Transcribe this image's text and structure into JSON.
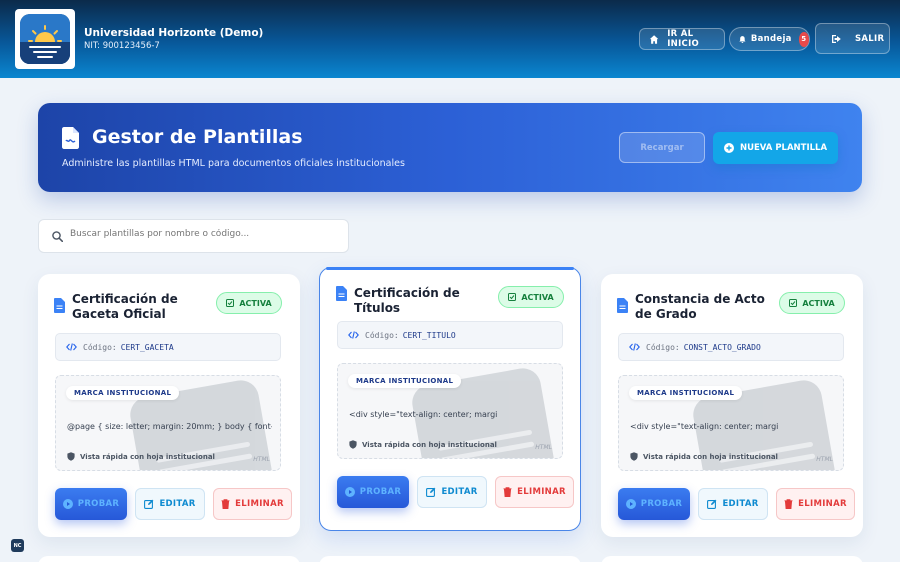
{
  "header": {
    "org_name": "Universidad Horizonte (Demo)",
    "org_nit": "NIT: 900123456-7",
    "home_label": "IR AL INICIO",
    "inbox_label": "Bandeja",
    "inbox_count": "5",
    "logout_label": "SALIR"
  },
  "hero": {
    "title": "Gestor de Plantillas",
    "subtitle": "Administre las plantillas HTML para documentos oficiales institucionales",
    "secondary_label": "Recargar",
    "new_label": "NUEVA PLANTILLA"
  },
  "search": {
    "placeholder": "Buscar plantillas por nombre o código..."
  },
  "labels": {
    "code_prefix": "Código:",
    "brand_chip": "MARCA INSTITUCIONAL",
    "quick_view": "Vista rápida con hoja institucional",
    "html_tag": "HTML",
    "try": "PROBAR",
    "edit": "EDITAR",
    "delete": "ELIMINAR"
  },
  "templates": [
    {
      "title": "Certificación de Gaceta Oficial",
      "status": "ACTIVA",
      "code": "CERT_GACETA",
      "snippet": "@page { size: letter; margin: 20mm; } body { font-famil"
    },
    {
      "title": "Certificación de Títulos",
      "status": "ACTIVA",
      "code": "CERT_TITULO",
      "snippet": "<div style=\"text-align: center; margi"
    },
    {
      "title": "Constancia de Acto de Grado",
      "status": "ACTIVA",
      "code": "CONST_ACTO_GRADO",
      "snippet": "<div style=\"text-align: center; margi"
    }
  ],
  "corner_badge": "NC",
  "colors": {
    "accent": "#2c60d6",
    "success": "#15803d",
    "danger": "#e33b3b",
    "info": "#0e8ad0"
  }
}
